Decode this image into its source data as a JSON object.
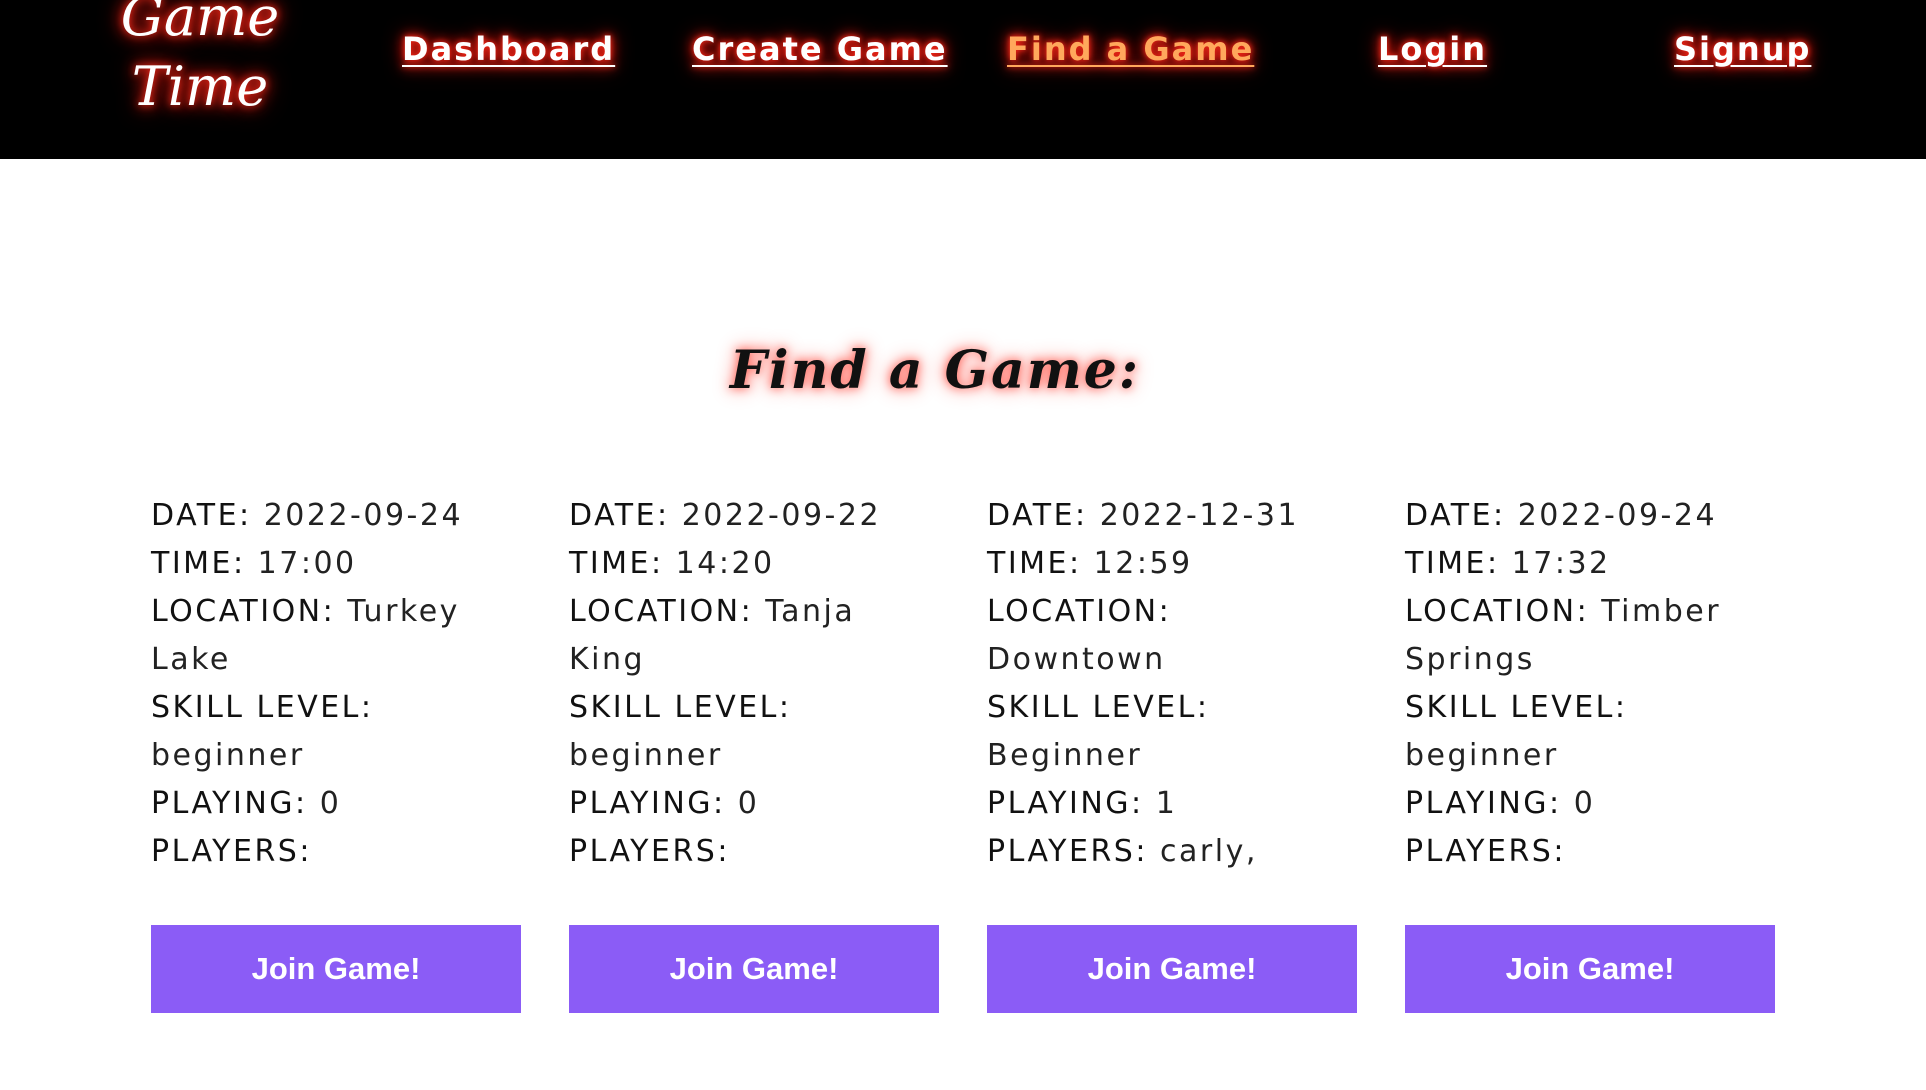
{
  "nav": {
    "logo_line1": "Game",
    "logo_line2": "Time",
    "links": [
      {
        "label": "Dashboard"
      },
      {
        "label": "Create Game"
      },
      {
        "label": "Find a Game",
        "active": true
      },
      {
        "label": "Login"
      },
      {
        "label": "Signup"
      }
    ],
    "glow_color": "#ff2a1a",
    "active_color": "#ffa85c"
  },
  "main": {
    "heading": "Find a Game:",
    "labels": {
      "date": "DATE:",
      "time": "TIME:",
      "location": "LOCATION:",
      "skill": "SKILL LEVEL:",
      "playing": "PLAYING:",
      "players": "PLAYERS:"
    },
    "join_label": "Join Game!",
    "button_color": "#8b5cf6",
    "games": [
      {
        "date": "2022-09-24",
        "time": "17:00",
        "location": "Turkey Lake",
        "skill": "beginner",
        "playing": "0",
        "players": ""
      },
      {
        "date": "2022-09-22",
        "time": "14:20",
        "location": "Tanja King",
        "skill": "beginner",
        "playing": "0",
        "players": ""
      },
      {
        "date": "2022-12-31",
        "time": "12:59",
        "location": "Downtown",
        "skill": "Beginner",
        "playing": "1",
        "players": "carly,"
      },
      {
        "date": "2022-09-24",
        "time": "17:32",
        "location": "Timber Springs",
        "skill": "beginner",
        "playing": "0",
        "players": ""
      }
    ]
  }
}
